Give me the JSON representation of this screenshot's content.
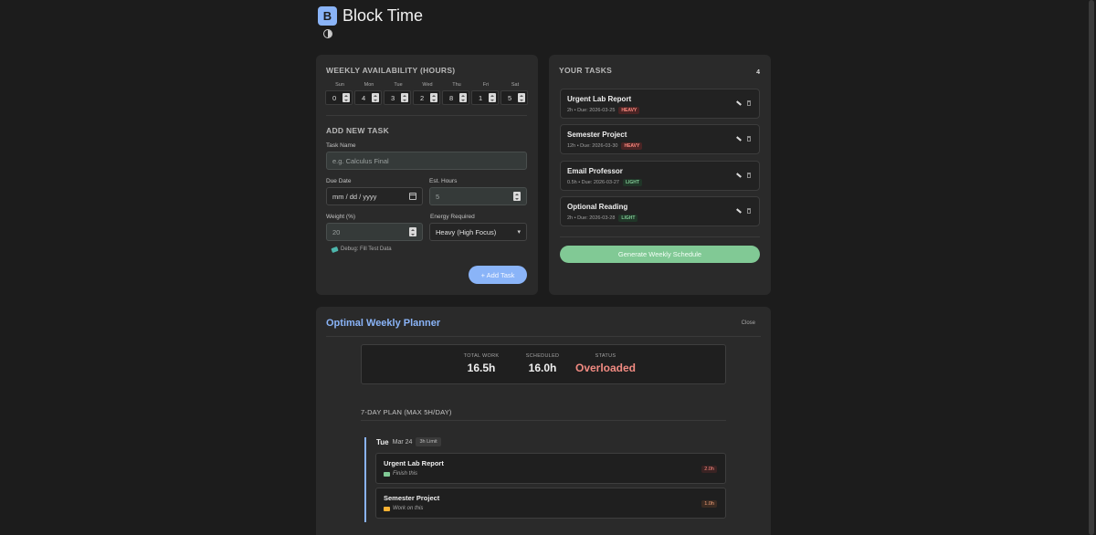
{
  "app": {
    "logo_letter": "B",
    "title": "Block Time"
  },
  "availability": {
    "title": "WEEKLY AVAILABILITY (HOURS)",
    "days": [
      {
        "label": "Sun",
        "value": "0"
      },
      {
        "label": "Mon",
        "value": "4"
      },
      {
        "label": "Tue",
        "value": "3"
      },
      {
        "label": "Wed",
        "value": "2"
      },
      {
        "label": "Thu",
        "value": "8"
      },
      {
        "label": "Fri",
        "value": "1"
      },
      {
        "label": "Sat",
        "value": "5"
      }
    ]
  },
  "add_task": {
    "title": "ADD NEW TASK",
    "name_label": "Task Name",
    "name_placeholder": "e.g. Calculus Final",
    "due_label": "Due Date",
    "due_placeholder": "mm / dd / yyyy",
    "hours_label": "Est. Hours",
    "hours_value": "5",
    "weight_label": "Weight (%)",
    "weight_value": "20",
    "energy_label": "Energy Required",
    "energy_value": "Heavy (High Focus)",
    "debug_label": "Debug: Fill Test Data",
    "add_button": "+ Add Task"
  },
  "tasks": {
    "title": "YOUR TASKS",
    "count": "4",
    "items": [
      {
        "name": "Urgent Lab Report",
        "meta": "2h • Due: 2026-03-25",
        "badge": "HEAVY"
      },
      {
        "name": "Semester Project",
        "meta": "12h • Due: 2026-03-30",
        "badge": "HEAVY"
      },
      {
        "name": "Email Professor",
        "meta": "0.5h • Due: 2026-03-27",
        "badge": "LIGHT"
      },
      {
        "name": "Optional Reading",
        "meta": "2h • Due: 2026-03-28",
        "badge": "LIGHT"
      }
    ],
    "generate_button": "Generate Weekly Schedule"
  },
  "planner": {
    "title": "Optimal Weekly Planner",
    "close": "Close",
    "summary": {
      "total_label": "TOTAL WORK",
      "total_value": "16.5h",
      "scheduled_label": "SCHEDULED",
      "scheduled_value": "16.0h",
      "status_label": "STATUS",
      "status_value": "Overloaded"
    },
    "plan_title": "7-DAY PLAN (MAX 5H/DAY)",
    "day": {
      "name": "Tue",
      "date": "Mar 24",
      "limit": "3h Limit"
    },
    "entries": [
      {
        "name": "Urgent Lab Report",
        "note": "Finish this",
        "hours": "2.0h"
      },
      {
        "name": "Semester Project",
        "note": "Work on this",
        "hours": "1.0h"
      }
    ]
  },
  "colors": {
    "accent": "#8ab4f8",
    "success": "#81c995",
    "danger": "#f28b82"
  }
}
